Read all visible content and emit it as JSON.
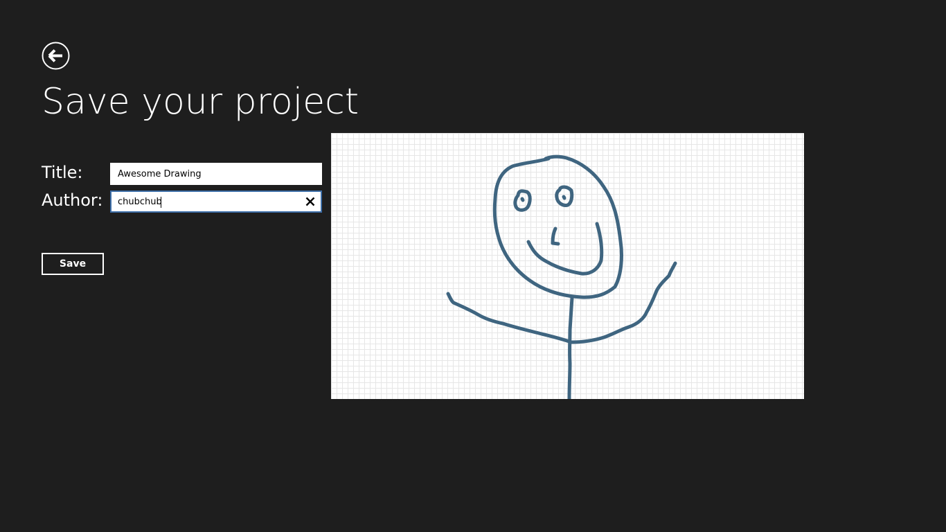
{
  "header": {
    "back_icon": "back-arrow-circle-icon",
    "title": "Save your project"
  },
  "form": {
    "title_label": "Title:",
    "title_value": "Awesome Drawing",
    "author_label": "Author:",
    "author_value": "chubchub",
    "clear_icon": "close-icon",
    "save_label": "Save"
  },
  "preview": {
    "subject": "stick figure drawing on grid paper",
    "stroke_color": "#3f6580",
    "background_color": "#ffffff",
    "grid_color": "#e6e6e6"
  },
  "colors": {
    "background": "#1e1e1e",
    "text": "#ffffff",
    "focus_border": "#3d6ea8"
  }
}
